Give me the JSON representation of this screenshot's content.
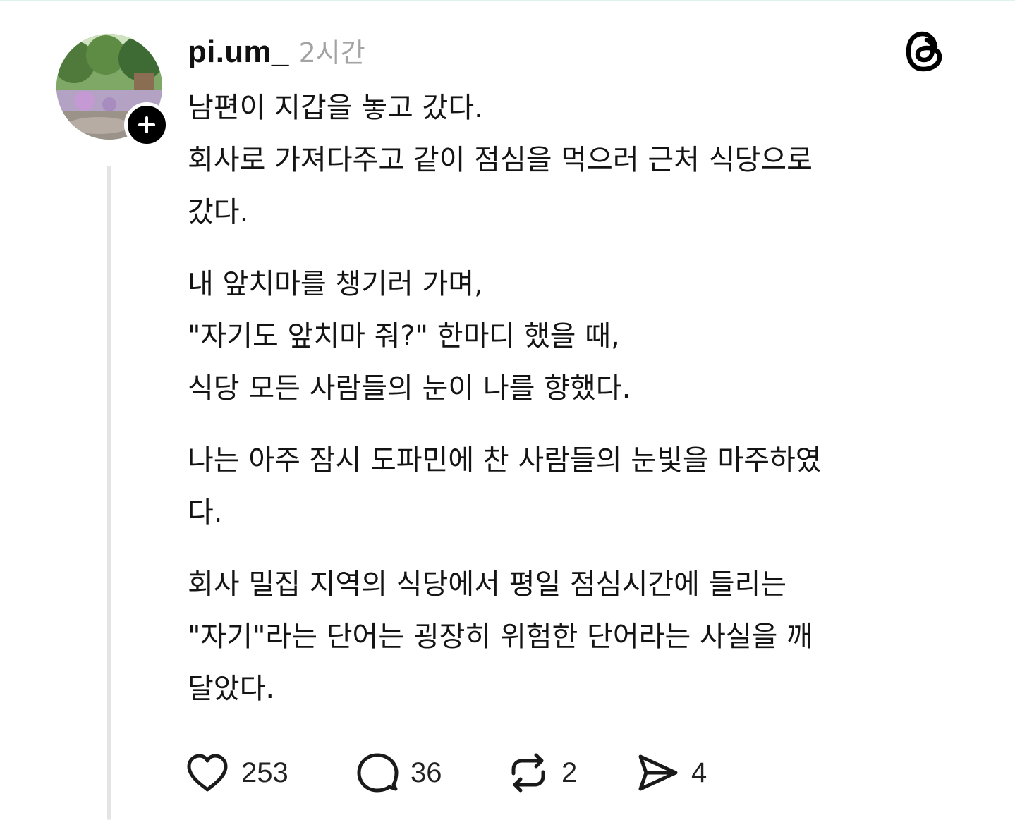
{
  "post": {
    "username": "pi.um_",
    "time": "2시간",
    "paragraphs": [
      [
        "남편이 지갑을 놓고 갔다.",
        "회사로 가져다주고 같이 점심을 먹으러 근처 식당으로",
        "갔다."
      ],
      [
        "내 앞치마를 챙기러 가며,",
        "\"자기도 앞치마 줘?\" 한마디 했을 때,",
        "식당 모든 사람들의 눈이 나를 향했다."
      ],
      [
        "나는 아주 잠시 도파민에 찬 사람들의 눈빛을 마주하였",
        "다."
      ],
      [
        "회사 밀집 지역의 식당에서 평일 점심시간에 들리는",
        "\"자기\"라는 단어는 굉장히 위험한 단어라는 사실을 깨",
        "달았다."
      ]
    ]
  },
  "actions": {
    "likes": "253",
    "replies": "36",
    "reposts": "2",
    "shares": "4"
  },
  "icons": {
    "like": "heart-icon",
    "reply": "comment-bubble-icon",
    "repost": "repost-icon",
    "share": "send-icon",
    "brand": "threads-logo-icon",
    "follow": "plus-icon"
  }
}
